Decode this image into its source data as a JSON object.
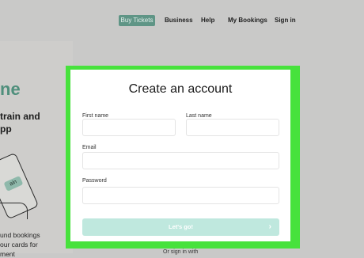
{
  "nav": {
    "buy_tickets": "Buy Tickets",
    "business": "Business",
    "help": "Help",
    "my_bookings": "My Bookings",
    "sign_in": "Sign in"
  },
  "hero": {
    "green_text": "ne",
    "line1": "train and",
    "line2": "pp",
    "phone_chip": "ain",
    "small1": "und bookings",
    "small2": "our cards for",
    "small3": "ment"
  },
  "form": {
    "title": "Create an account",
    "first_name_label": "First name",
    "last_name_label": "Last name",
    "email_label": "Email",
    "password_label": "Password",
    "submit_label": "Let's go!",
    "submit_arrow": "›",
    "below_text": "Or sign in with"
  },
  "colors": {
    "accent": "#5f9586",
    "highlight_frame": "#47e23c",
    "submit_bg": "#bfe8de"
  }
}
